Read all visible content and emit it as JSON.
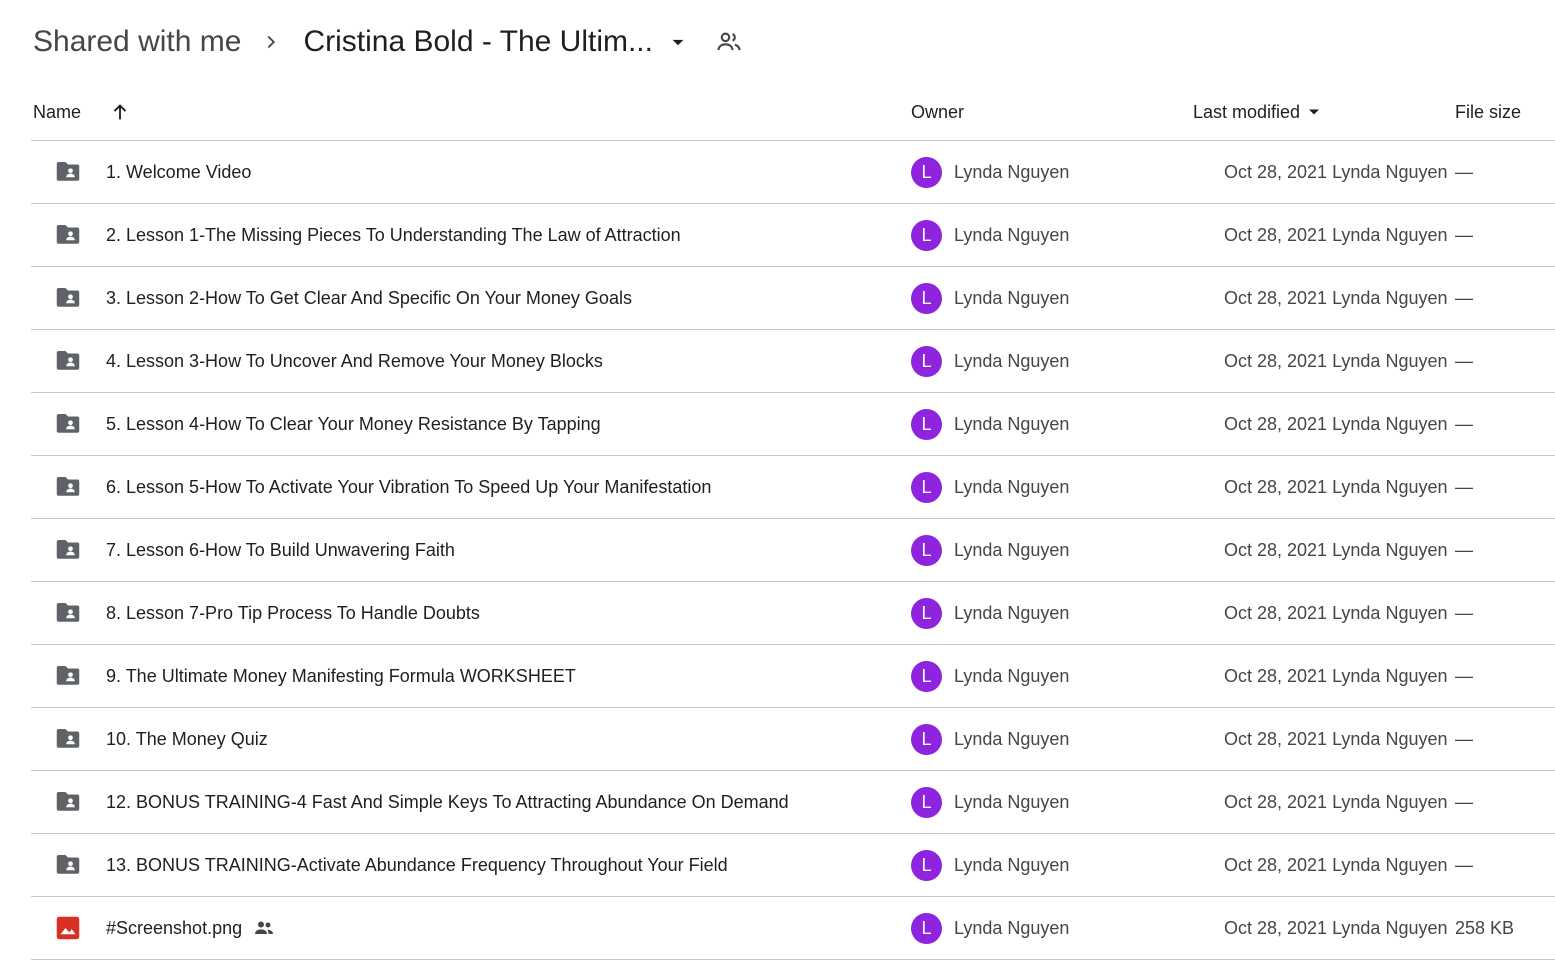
{
  "breadcrumb": {
    "root": "Shared with me",
    "current": "Cristina Bold - The Ultim..."
  },
  "columns": {
    "name": "Name",
    "owner": "Owner",
    "modified": "Last modified",
    "size": "File size"
  },
  "colors": {
    "avatar": "#8e24dd",
    "folder": "#5f6368",
    "image_icon": "#d93025"
  },
  "files": [
    {
      "name": "1. Welcome Video",
      "type": "shared-folder",
      "owner_initial": "L",
      "owner": "Lynda Nguyen",
      "modified": "Oct 28, 2021 Lynda Nguyen",
      "size": "—"
    },
    {
      "name": "2. Lesson 1-The Missing Pieces To Understanding The Law of Attraction",
      "type": "shared-folder",
      "owner_initial": "L",
      "owner": "Lynda Nguyen",
      "modified": "Oct 28, 2021 Lynda Nguyen",
      "size": "—"
    },
    {
      "name": "3. Lesson 2-How To Get Clear And Specific On Your Money Goals",
      "type": "shared-folder",
      "owner_initial": "L",
      "owner": "Lynda Nguyen",
      "modified": "Oct 28, 2021 Lynda Nguyen",
      "size": "—"
    },
    {
      "name": "4. Lesson 3-How To Uncover And Remove Your Money Blocks",
      "type": "shared-folder",
      "owner_initial": "L",
      "owner": "Lynda Nguyen",
      "modified": "Oct 28, 2021 Lynda Nguyen",
      "size": "—"
    },
    {
      "name": "5. Lesson 4-How To Clear Your Money Resistance By Tapping",
      "type": "shared-folder",
      "owner_initial": "L",
      "owner": "Lynda Nguyen",
      "modified": "Oct 28, 2021 Lynda Nguyen",
      "size": "—"
    },
    {
      "name": "6. Lesson 5-How To Activate Your Vibration To Speed Up Your Manifestation",
      "type": "shared-folder",
      "owner_initial": "L",
      "owner": "Lynda Nguyen",
      "modified": "Oct 28, 2021 Lynda Nguyen",
      "size": "—"
    },
    {
      "name": "7. Lesson 6-How To Build Unwavering Faith",
      "type": "shared-folder",
      "owner_initial": "L",
      "owner": "Lynda Nguyen",
      "modified": "Oct 28, 2021 Lynda Nguyen",
      "size": "—"
    },
    {
      "name": "8. Lesson 7-Pro Tip Process To Handle Doubts",
      "type": "shared-folder",
      "owner_initial": "L",
      "owner": "Lynda Nguyen",
      "modified": "Oct 28, 2021 Lynda Nguyen",
      "size": "—"
    },
    {
      "name": "9. The Ultimate Money Manifesting Formula WORKSHEET",
      "type": "shared-folder",
      "owner_initial": "L",
      "owner": "Lynda Nguyen",
      "modified": "Oct 28, 2021 Lynda Nguyen",
      "size": "—"
    },
    {
      "name": "10. The Money Quiz",
      "type": "shared-folder",
      "owner_initial": "L",
      "owner": "Lynda Nguyen",
      "modified": "Oct 28, 2021 Lynda Nguyen",
      "size": "—"
    },
    {
      "name": "12. BONUS TRAINING-4 Fast And Simple Keys To Attracting Abundance On Demand",
      "type": "shared-folder",
      "owner_initial": "L",
      "owner": "Lynda Nguyen",
      "modified": "Oct 28, 2021 Lynda Nguyen",
      "size": "—"
    },
    {
      "name": "13. BONUS TRAINING-Activate Abundance Frequency Throughout Your Field",
      "type": "shared-folder",
      "owner_initial": "L",
      "owner": "Lynda Nguyen",
      "modified": "Oct 28, 2021 Lynda Nguyen",
      "size": "—"
    },
    {
      "name": "#Screenshot.png",
      "type": "image",
      "shared": true,
      "owner_initial": "L",
      "owner": "Lynda Nguyen",
      "modified": "Oct 28, 2021 Lynda Nguyen",
      "size": "258 KB"
    }
  ]
}
